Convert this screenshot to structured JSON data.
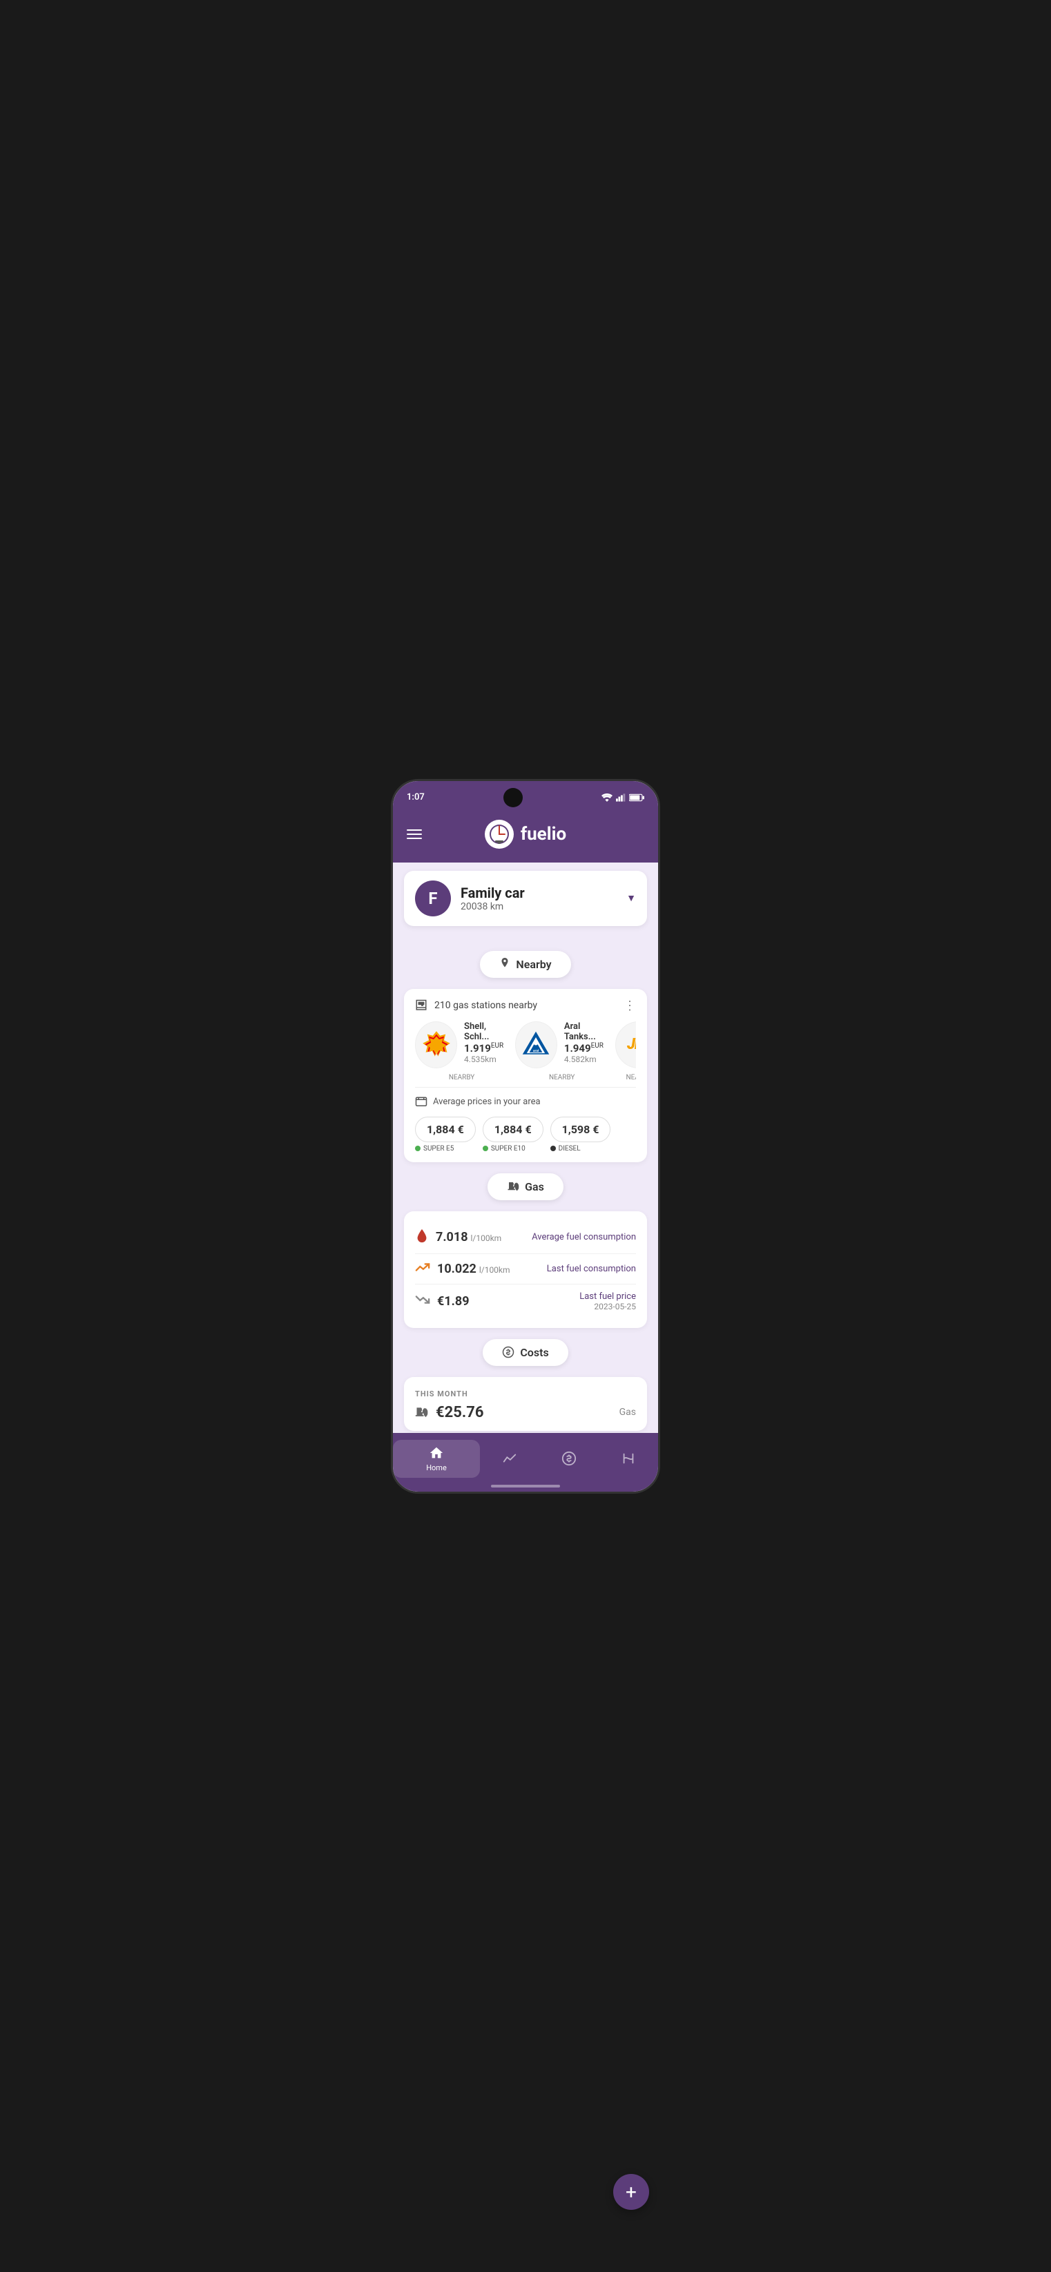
{
  "statusBar": {
    "time": "1:07",
    "wifiIcon": "wifi",
    "signalIcon": "signal",
    "batteryIcon": "battery"
  },
  "header": {
    "appName": "fuelio",
    "menuIcon": "menu"
  },
  "carSelector": {
    "initial": "F",
    "name": "Family car",
    "mileage": "20038 km"
  },
  "nearby": {
    "sectionLabel": "Nearby",
    "locationIcon": "location-pin",
    "stationsCount": "210 gas stations nearby",
    "moreIcon": "more-vertical",
    "stations": [
      {
        "name": "Shell, Schl...",
        "price": "1.919",
        "currency": "EUR",
        "distance": "4.535km",
        "label": "NEARBY",
        "logo": "shell"
      },
      {
        "name": "Aral Tanks...",
        "price": "1.949",
        "currency": "EUR",
        "distance": "4.582km",
        "label": "NEARBY",
        "logo": "aral"
      },
      {
        "name": "",
        "price": "",
        "currency": "",
        "distance": "",
        "label": "NEARBY",
        "logo": "jet"
      }
    ],
    "avgPricesTitle": "Average prices in your area",
    "avgPrices": [
      {
        "value": "1,884 €",
        "fuel": "SUPER E5",
        "dotColor": "green"
      },
      {
        "value": "1,884 €",
        "fuel": "SUPER E10",
        "dotColor": "green"
      },
      {
        "value": "1,598 €",
        "fuel": "DIESEL",
        "dotColor": "black"
      }
    ]
  },
  "gas": {
    "sectionLabel": "Gas",
    "gasIcon": "gas-pump",
    "stats": [
      {
        "icon": "droplet",
        "value": "7.018",
        "unit": "l/100km",
        "label": "Average fuel consumption",
        "iconColor": "#c0392b"
      },
      {
        "icon": "trending-up",
        "value": "10.022",
        "unit": "l/100km",
        "label": "Last fuel consumption",
        "iconColor": "#e67e22"
      },
      {
        "icon": "trending-down",
        "value": "€1.89",
        "unit": "",
        "label": "Last fuel price",
        "iconColor": "#888",
        "date": "2023-05-25"
      }
    ]
  },
  "costs": {
    "sectionLabel": "Costs",
    "costsIcon": "dollar-circle",
    "thisMonth": "THIS MONTH",
    "amount": "€25.76",
    "type": "Gas"
  },
  "fab": {
    "label": "+"
  },
  "bottomNav": [
    {
      "icon": "home",
      "label": "Home",
      "active": true
    },
    {
      "icon": "chart",
      "label": "",
      "active": false
    },
    {
      "icon": "dollar",
      "label": "",
      "active": false
    },
    {
      "icon": "route",
      "label": "",
      "active": false
    }
  ]
}
